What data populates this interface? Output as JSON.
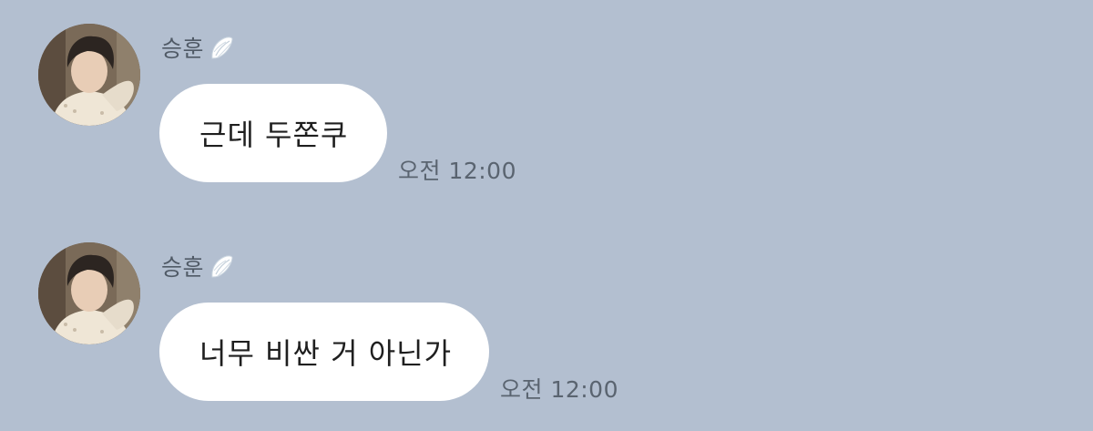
{
  "chat": {
    "messages": [
      {
        "sender": "승훈",
        "sender_badge_icon": "angel-wing-icon",
        "text": "근데 두쫀쿠",
        "time": "오전 12:00"
      },
      {
        "sender": "승훈",
        "sender_badge_icon": "angel-wing-icon",
        "text": "너무 비싼 거 아닌가",
        "time": "오전 12:00"
      }
    ]
  },
  "colors": {
    "background": "#b3bfd0",
    "bubble": "#ffffff",
    "text": "#1f1f1f",
    "meta_text": "#5a6470"
  }
}
